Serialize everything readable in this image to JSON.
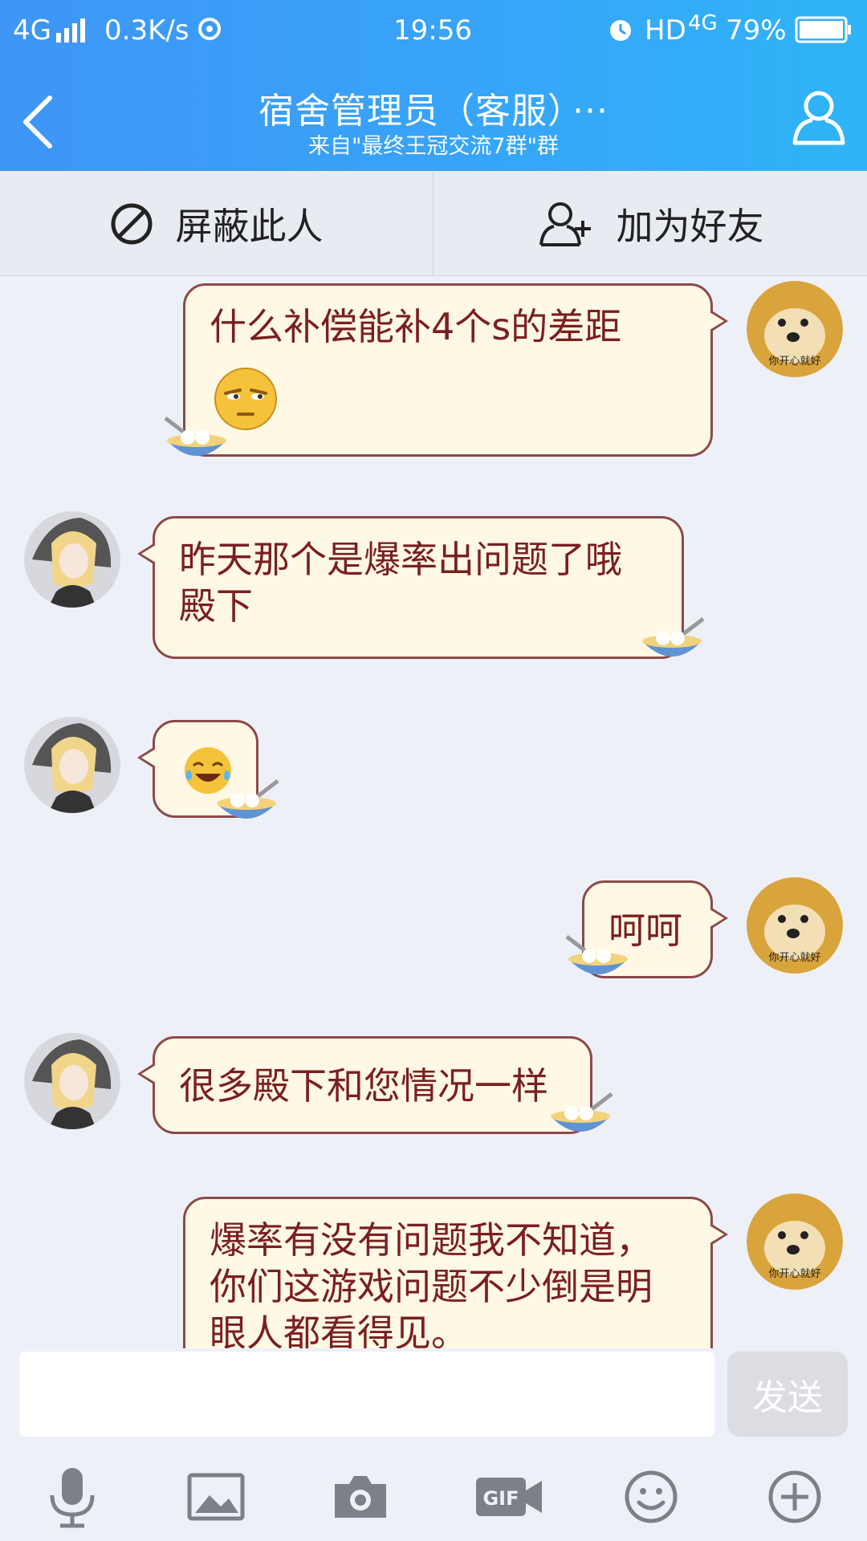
{
  "status_bar": {
    "network": "4G",
    "speed": "0.3K/s",
    "time": "19:56",
    "hd": "HD",
    "net2": "4G",
    "battery": "79%"
  },
  "header": {
    "title": "宿舍管理员（客服）",
    "title_more": "···",
    "subtitle": "来自\"最终王冠交流7群\"群"
  },
  "actions": {
    "block_label": "屏蔽此人",
    "add_friend_label": "加为好友"
  },
  "messages": [
    {
      "side": "outgoing",
      "lines": [
        "什么补偿能补4个s的差距"
      ],
      "has_emoji": "unamused-face"
    },
    {
      "side": "incoming",
      "lines": [
        "昨天那个是爆率出问题了哦",
        "殿下"
      ]
    },
    {
      "side": "incoming",
      "lines": [],
      "has_emoji": "tears-of-joy"
    },
    {
      "side": "outgoing",
      "lines": [
        "呵呵"
      ]
    },
    {
      "side": "incoming",
      "lines": [
        "很多殿下和您情况一样"
      ]
    },
    {
      "side": "outgoing",
      "lines": [
        "爆率有没有问题我不知道，",
        "你们这游戏问题不少倒是明",
        "眼人都看得见。"
      ]
    }
  ],
  "avatar_caption": "你开心就好",
  "input": {
    "placeholder": "",
    "send_label": "发送"
  },
  "toolbar": [
    "microphone-icon",
    "image-icon",
    "camera-icon",
    "gif-icon",
    "smiley-icon",
    "plus-icon"
  ],
  "colors": {
    "header_start": "#3f95f6",
    "header_end": "#2fb4f7",
    "bubble_fill": "#fff8e4",
    "bubble_border": "#8b4a4a",
    "bubble_text": "#7a1f1f"
  }
}
